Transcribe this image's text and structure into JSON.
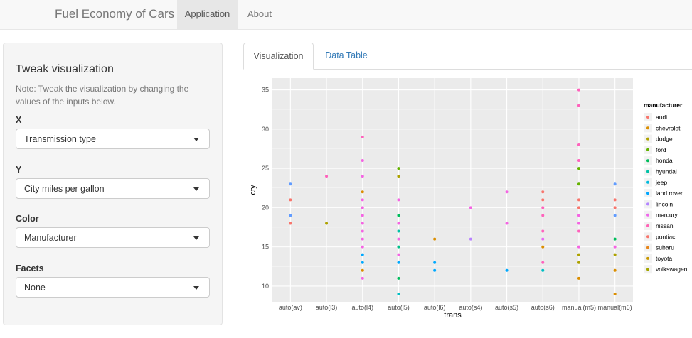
{
  "navbar": {
    "brand": "Fuel Economy of Cars",
    "items": [
      {
        "label": "Application",
        "active": true
      },
      {
        "label": "About",
        "active": false
      }
    ]
  },
  "sidebar": {
    "title": "Tweak visualization",
    "note": "Note: Tweak the visualization by changing the values of the inputs below.",
    "fields": [
      {
        "label": "X",
        "value": "Transmission type"
      },
      {
        "label": "Y",
        "value": "City miles per gallon"
      },
      {
        "label": "Color",
        "value": "Manufacturer"
      },
      {
        "label": "Facets",
        "value": "None"
      }
    ]
  },
  "tabs": [
    {
      "label": "Visualization",
      "active": true
    },
    {
      "label": "Data Table",
      "active": false
    }
  ],
  "colors": {
    "panel_bg": "#ebebeb",
    "grid": "#ffffff",
    "link": "#337ab7"
  },
  "chart_data": {
    "type": "scatter",
    "xlabel": "trans",
    "ylabel": "cty",
    "categories": [
      "auto(av)",
      "auto(l3)",
      "auto(l4)",
      "auto(l5)",
      "auto(l6)",
      "auto(s4)",
      "auto(s5)",
      "auto(s6)",
      "manual(m5)",
      "manual(m6)"
    ],
    "yticks": [
      10,
      15,
      20,
      25,
      30,
      35
    ],
    "ylim": [
      8,
      36.5
    ],
    "grid": true,
    "legend": {
      "title": "manufacturer",
      "placement": "right",
      "entries": [
        {
          "name": "audi",
          "color": "#F8766D"
        },
        {
          "name": "chevrolet",
          "color": "#DB8E00"
        },
        {
          "name": "dodge",
          "color": "#AEA200"
        },
        {
          "name": "ford",
          "color": "#64B200"
        },
        {
          "name": "honda",
          "color": "#00BD5C"
        },
        {
          "name": "hyundai",
          "color": "#00C1A7"
        },
        {
          "name": "jeep",
          "color": "#00BADE"
        },
        {
          "name": "land rover",
          "color": "#00A6FF"
        },
        {
          "name": "lincoln",
          "color": "#B385FF"
        },
        {
          "name": "mercury",
          "color": "#EF67EB"
        },
        {
          "name": "nissan",
          "color": "#FF63B6"
        },
        {
          "name": "pontiac",
          "color": "#F8766D"
        },
        {
          "name": "subaru",
          "color": "#E7861B"
        },
        {
          "name": "toyota",
          "color": "#C99800"
        },
        {
          "name": "volkswagen",
          "color": "#A3A500"
        }
      ]
    },
    "points": [
      {
        "x": "auto(av)",
        "y": 23,
        "c": "#619CFF"
      },
      {
        "x": "auto(av)",
        "y": 21,
        "c": "#F8766D"
      },
      {
        "x": "auto(av)",
        "y": 19,
        "c": "#619CFF"
      },
      {
        "x": "auto(av)",
        "y": 18,
        "c": "#F8766D"
      },
      {
        "x": "auto(l3)",
        "y": 24,
        "c": "#FF62BC"
      },
      {
        "x": "auto(l3)",
        "y": 18,
        "c": "#AEA200"
      },
      {
        "x": "auto(l4)",
        "y": 29,
        "c": "#FF62BC"
      },
      {
        "x": "auto(l4)",
        "y": 26,
        "c": "#F564E3"
      },
      {
        "x": "auto(l4)",
        "y": 24,
        "c": "#F564E3"
      },
      {
        "x": "auto(l4)",
        "y": 22,
        "c": "#DB8E00"
      },
      {
        "x": "auto(l4)",
        "y": 21,
        "c": "#F564E3"
      },
      {
        "x": "auto(l4)",
        "y": 20,
        "c": "#F564E3"
      },
      {
        "x": "auto(l4)",
        "y": 19,
        "c": "#F564E3"
      },
      {
        "x": "auto(l4)",
        "y": 18,
        "c": "#F564E3"
      },
      {
        "x": "auto(l4)",
        "y": 17,
        "c": "#F564E3"
      },
      {
        "x": "auto(l4)",
        "y": 16,
        "c": "#F564E3"
      },
      {
        "x": "auto(l4)",
        "y": 15,
        "c": "#F564E3"
      },
      {
        "x": "auto(l4)",
        "y": 14,
        "c": "#00A9FF"
      },
      {
        "x": "auto(l4)",
        "y": 13,
        "c": "#00A9FF"
      },
      {
        "x": "auto(l4)",
        "y": 12,
        "c": "#DB8E00"
      },
      {
        "x": "auto(l4)",
        "y": 11,
        "c": "#F564E3"
      },
      {
        "x": "auto(l5)",
        "y": 25,
        "c": "#64B200"
      },
      {
        "x": "auto(l5)",
        "y": 24,
        "c": "#AEA200"
      },
      {
        "x": "auto(l5)",
        "y": 21,
        "c": "#F564E3"
      },
      {
        "x": "auto(l5)",
        "y": 19,
        "c": "#00BD5C"
      },
      {
        "x": "auto(l5)",
        "y": 18,
        "c": "#F564E3"
      },
      {
        "x": "auto(l5)",
        "y": 17,
        "c": "#00C1A7"
      },
      {
        "x": "auto(l5)",
        "y": 16,
        "c": "#F564E3"
      },
      {
        "x": "auto(l5)",
        "y": 15,
        "c": "#00C08B"
      },
      {
        "x": "auto(l5)",
        "y": 14,
        "c": "#F564E3"
      },
      {
        "x": "auto(l5)",
        "y": 13,
        "c": "#00A9FF"
      },
      {
        "x": "auto(l5)",
        "y": 11,
        "c": "#00BD5C"
      },
      {
        "x": "auto(l5)",
        "y": 9,
        "c": "#00BFC4"
      },
      {
        "x": "auto(l6)",
        "y": 16,
        "c": "#DB8E00"
      },
      {
        "x": "auto(l6)",
        "y": 13,
        "c": "#00A9FF"
      },
      {
        "x": "auto(l6)",
        "y": 12,
        "c": "#00A9FF"
      },
      {
        "x": "auto(s4)",
        "y": 20,
        "c": "#F564E3"
      },
      {
        "x": "auto(s4)",
        "y": 16,
        "c": "#B983FF"
      },
      {
        "x": "auto(s5)",
        "y": 22,
        "c": "#F564E3"
      },
      {
        "x": "auto(s5)",
        "y": 18,
        "c": "#F564E3"
      },
      {
        "x": "auto(s5)",
        "y": 12,
        "c": "#00A9FF"
      },
      {
        "x": "auto(s6)",
        "y": 22,
        "c": "#F8766D"
      },
      {
        "x": "auto(s6)",
        "y": 21,
        "c": "#F8766D"
      },
      {
        "x": "auto(s6)",
        "y": 20,
        "c": "#FF62BC"
      },
      {
        "x": "auto(s6)",
        "y": 19,
        "c": "#FF62BC"
      },
      {
        "x": "auto(s6)",
        "y": 17,
        "c": "#FF62BC"
      },
      {
        "x": "auto(s6)",
        "y": 16,
        "c": "#E76BF3"
      },
      {
        "x": "auto(s6)",
        "y": 15,
        "c": "#DB8E00"
      },
      {
        "x": "auto(s6)",
        "y": 13,
        "c": "#FF62BC"
      },
      {
        "x": "auto(s6)",
        "y": 12,
        "c": "#00BFC4"
      },
      {
        "x": "manual(m5)",
        "y": 35,
        "c": "#FF62BC"
      },
      {
        "x": "manual(m5)",
        "y": 33,
        "c": "#FF62BC"
      },
      {
        "x": "manual(m5)",
        "y": 28,
        "c": "#FF62BC"
      },
      {
        "x": "manual(m5)",
        "y": 26,
        "c": "#FF62BC"
      },
      {
        "x": "manual(m5)",
        "y": 25,
        "c": "#64B200"
      },
      {
        "x": "manual(m5)",
        "y": 23,
        "c": "#64B200"
      },
      {
        "x": "manual(m5)",
        "y": 21,
        "c": "#F8766D"
      },
      {
        "x": "manual(m5)",
        "y": 20,
        "c": "#F8766D"
      },
      {
        "x": "manual(m5)",
        "y": 19,
        "c": "#F564E3"
      },
      {
        "x": "manual(m5)",
        "y": 18,
        "c": "#F564E3"
      },
      {
        "x": "manual(m5)",
        "y": 17,
        "c": "#FF62BC"
      },
      {
        "x": "manual(m5)",
        "y": 15,
        "c": "#F564E3"
      },
      {
        "x": "manual(m5)",
        "y": 14,
        "c": "#AEA200"
      },
      {
        "x": "manual(m5)",
        "y": 13,
        "c": "#AEA200"
      },
      {
        "x": "manual(m5)",
        "y": 11,
        "c": "#DB8E00"
      },
      {
        "x": "manual(m6)",
        "y": 23,
        "c": "#619CFF"
      },
      {
        "x": "manual(m6)",
        "y": 21,
        "c": "#F8766D"
      },
      {
        "x": "manual(m6)",
        "y": 20,
        "c": "#F8766D"
      },
      {
        "x": "manual(m6)",
        "y": 19,
        "c": "#619CFF"
      },
      {
        "x": "manual(m6)",
        "y": 16,
        "c": "#00BD5C"
      },
      {
        "x": "manual(m6)",
        "y": 15,
        "c": "#F564E3"
      },
      {
        "x": "manual(m6)",
        "y": 14,
        "c": "#AEA200"
      },
      {
        "x": "manual(m6)",
        "y": 12,
        "c": "#DB8E00"
      },
      {
        "x": "manual(m6)",
        "y": 9,
        "c": "#DB8E00"
      }
    ]
  }
}
